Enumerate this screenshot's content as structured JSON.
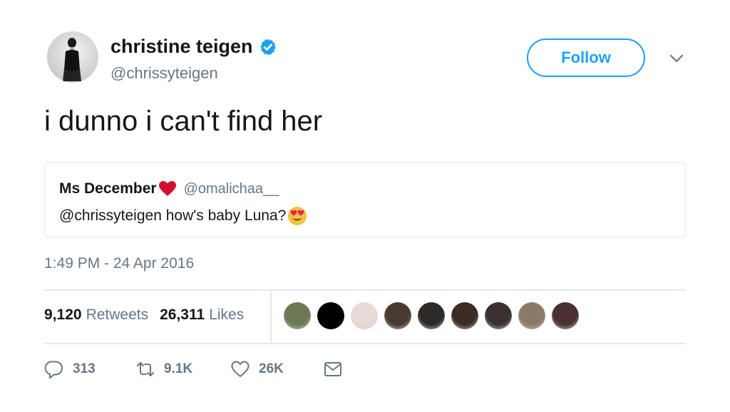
{
  "author": {
    "display_name": "christine teigen",
    "handle": "@chrissyteigen",
    "verified": true,
    "avatar": "profile-photo"
  },
  "follow_button": {
    "label": "Follow"
  },
  "menu": {
    "icon": "chevron-down-icon"
  },
  "tweet": {
    "text": "i dunno i can't find her"
  },
  "quoted_tweet": {
    "display_name": "Ms December",
    "name_emoji": "red-heart",
    "handle": "@omalichaa__",
    "text": "@chrissyteigen how's baby Luna?",
    "text_emoji": "heart-eyes-emoji"
  },
  "timestamp": "1:49 PM - 24 Apr 2016",
  "stats": {
    "retweets_count": "9,120",
    "retweets_label": "Retweets",
    "likes_count": "26,311",
    "likes_label": "Likes"
  },
  "liker_avatars": [
    {
      "color": "#6b7a52"
    },
    {
      "color": "#000000"
    },
    {
      "color": "#e8d9d4"
    },
    {
      "color": "#4a3a32"
    },
    {
      "color": "#2e2a28"
    },
    {
      "color": "#3b2c26"
    },
    {
      "color": "#3a3030"
    },
    {
      "color": "#8a7a64"
    },
    {
      "color": "#4a3030"
    }
  ],
  "actions": {
    "reply_count": "313",
    "retweet_count": "9.1K",
    "like_count": "26K",
    "dm_icon": "envelope-icon"
  },
  "colors": {
    "accent": "#1da1f2",
    "secondary_text": "#657786",
    "border": "#e1e8ed",
    "heart": "#d3102c"
  }
}
